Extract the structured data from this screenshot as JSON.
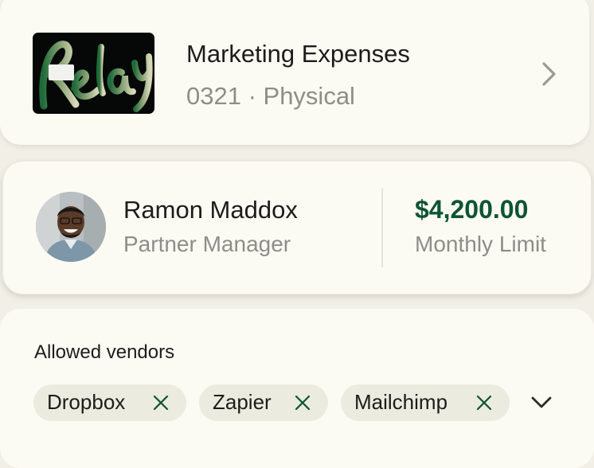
{
  "card": {
    "brand": "Relay",
    "name": "Marketing Expenses",
    "details": "0321 · Physical"
  },
  "assignee": {
    "name": "Ramon Maddox",
    "role": "Partner Manager"
  },
  "limit": {
    "amount": "$4,200.00",
    "label": "Monthly Limit"
  },
  "vendors": {
    "label": "Allowed vendors",
    "items": [
      "Dropbox",
      "Zapier",
      "Mailchimp"
    ]
  },
  "colors": {
    "accent": "#0d5433",
    "background": "#f1efe6",
    "surface": "#fcfbf3",
    "chip": "#ecebdf",
    "muted_text": "#8d8d8a"
  },
  "icons": {
    "card_chevron": "chevron-right-icon",
    "remove_vendor": "close-icon",
    "expand_vendors": "chevron-down-icon"
  }
}
